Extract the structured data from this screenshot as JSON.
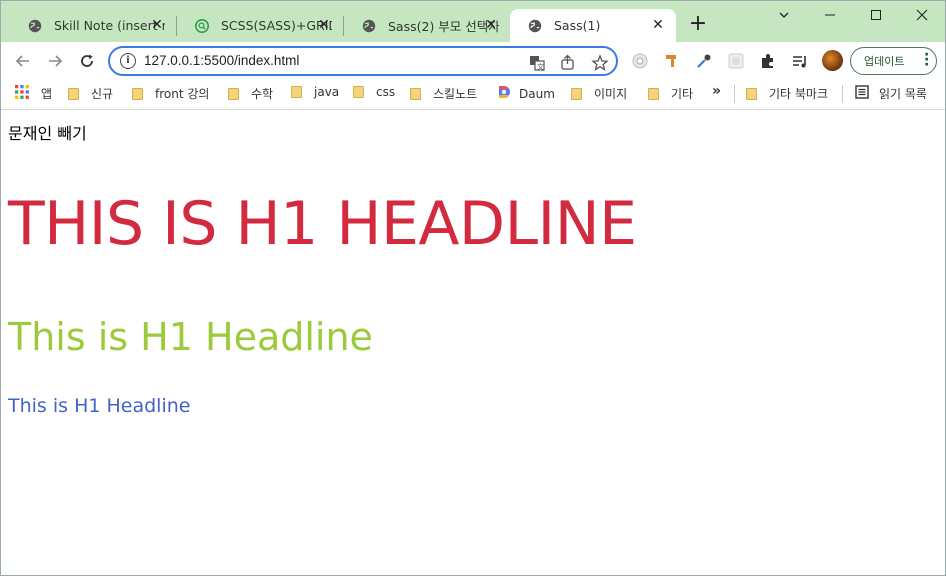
{
  "tabs": [
    {
      "title": "Skill Note (insert m",
      "favicon": "globe-icon"
    },
    {
      "title": "SCSS(SASS)+GRID-",
      "favicon": "search-icon"
    },
    {
      "title": "Sass(2) 부모 선택자",
      "favicon": "globe-icon"
    },
    {
      "title": "Sass(1)",
      "favicon": "globe-icon",
      "active": true
    }
  ],
  "toolbar": {
    "url": "127.0.0.1:5500/index.html",
    "update_label": "업데이트"
  },
  "bookmarks": [
    {
      "label": "앱",
      "icon": "apps-grid-icon"
    },
    {
      "label": "신규",
      "icon": "folder-icon"
    },
    {
      "label": "front 강의",
      "icon": "folder-icon"
    },
    {
      "label": "수학",
      "icon": "folder-icon"
    },
    {
      "label": "java",
      "icon": "folder-icon"
    },
    {
      "label": "css",
      "icon": "folder-icon"
    },
    {
      "label": "스킬노트",
      "icon": "folder-icon"
    },
    {
      "label": "Daum",
      "icon": "daum-icon"
    },
    {
      "label": "이미지",
      "icon": "folder-icon"
    },
    {
      "label": "기타",
      "icon": "folder-icon"
    },
    {
      "label": "»",
      "icon": "more-icon"
    },
    {
      "label": "기타 북마크",
      "icon": "folder-icon"
    },
    {
      "label": "읽기 목록",
      "icon": "reading-list-icon"
    }
  ],
  "page": {
    "text": "문재인 빼기",
    "h1_big": "THIS IS H1 HEADLINE",
    "h1_mid": "This is H1 Headline",
    "h1_small": "This is H1 Headline"
  },
  "colors": {
    "tabstrip": "#c6e6c1",
    "h1_big": "#d42a40",
    "h1_mid": "#9bcb3a",
    "h1_small": "#4363c9",
    "omnibox_border": "#3c7ae4"
  }
}
